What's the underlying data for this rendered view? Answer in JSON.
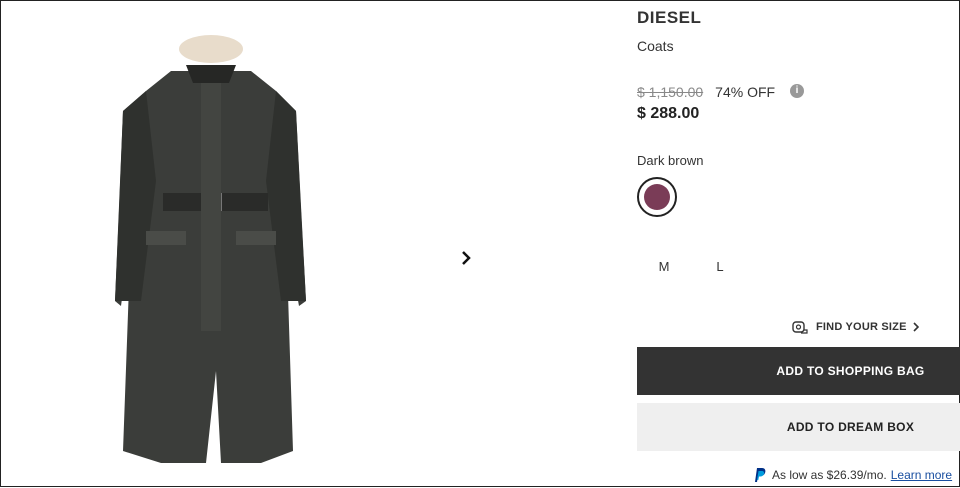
{
  "product": {
    "brand": "DIESEL",
    "category": "Coats",
    "original_price": "$ 1,150.00",
    "discount": "74% OFF",
    "price": "$ 288.00",
    "color_name": "Dark brown",
    "swatch_color": "#7a3c57"
  },
  "sizes": [
    "M",
    "L"
  ],
  "find_your_size": "FIND YOUR SIZE",
  "buttons": {
    "add_to_bag": "ADD TO SHOPPING BAG",
    "add_to_dream": "ADD TO DREAM BOX"
  },
  "paypal": {
    "text": "As low as $26.39/mo.",
    "link": "Learn more"
  },
  "icons": {
    "info": "info-icon",
    "next": "chevron-right-icon",
    "measure": "measuring-tape-icon",
    "paypal": "paypal-icon"
  }
}
